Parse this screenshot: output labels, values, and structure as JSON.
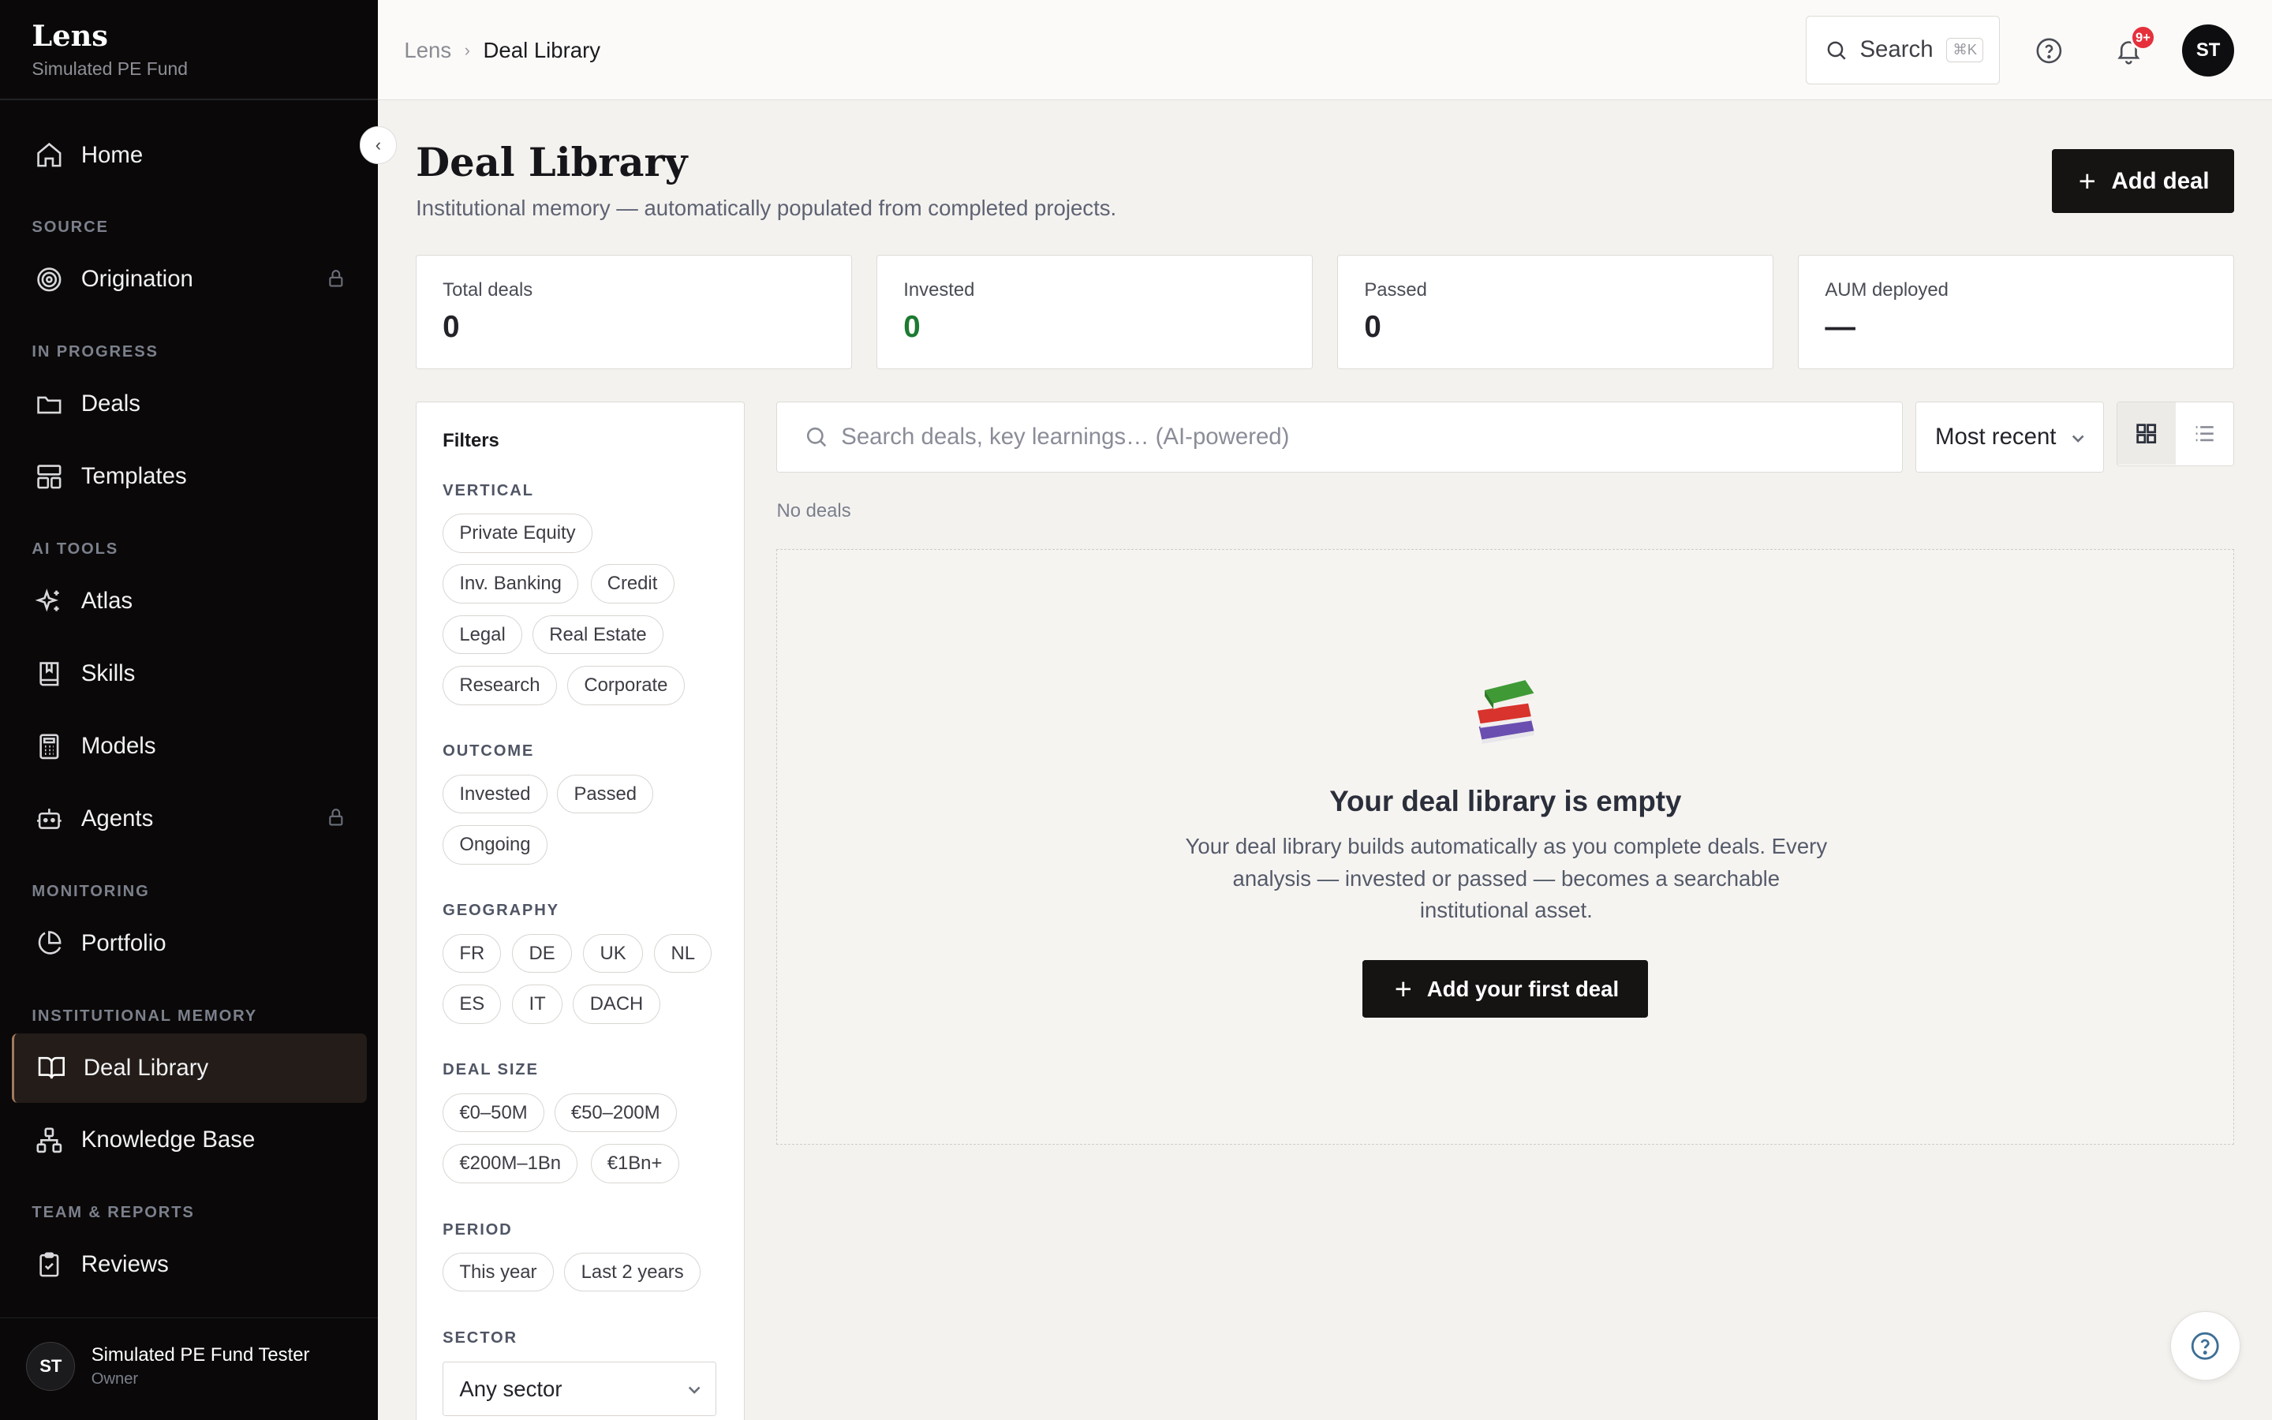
{
  "sidebar": {
    "brand_title": "Lens",
    "brand_subtitle": "Simulated PE Fund",
    "home": "Home",
    "sections": [
      "SOURCE",
      "IN PROGRESS",
      "AI TOOLS",
      "MONITORING",
      "INSTITUTIONAL MEMORY",
      "TEAM & REPORTS"
    ],
    "items": {
      "origination": "Origination",
      "deals": "Deals",
      "templates": "Templates",
      "atlas": "Atlas",
      "skills": "Skills",
      "models": "Models",
      "agents": "Agents",
      "portfolio": "Portfolio",
      "deal_library": "Deal Library",
      "knowledge_base": "Knowledge Base",
      "reviews": "Reviews"
    },
    "user": {
      "initials": "ST",
      "name": "Simulated PE Fund Tester",
      "role": "Owner"
    }
  },
  "topbar": {
    "breadcrumb": [
      "Lens",
      "Deal Library"
    ],
    "search_label": "Search",
    "search_shortcut": "⌘K",
    "notifications_badge": "9+",
    "avatar_initials": "ST"
  },
  "page": {
    "title": "Deal Library",
    "subtitle": "Institutional memory — automatically populated from completed projects.",
    "add_deal_label": "Add deal"
  },
  "stats": [
    {
      "label": "Total deals",
      "value": "0"
    },
    {
      "label": "Invested",
      "value": "0"
    },
    {
      "label": "Passed",
      "value": "0"
    },
    {
      "label": "AUM deployed",
      "value": "—"
    }
  ],
  "filters": {
    "title": "Filters",
    "vertical": {
      "label": "VERTICAL",
      "options": [
        "Private Equity",
        "Inv. Banking",
        "Credit",
        "Legal",
        "Real Estate",
        "Research",
        "Corporate"
      ]
    },
    "outcome": {
      "label": "OUTCOME",
      "options": [
        "Invested",
        "Passed",
        "Ongoing"
      ]
    },
    "geography": {
      "label": "GEOGRAPHY",
      "options": [
        "FR",
        "DE",
        "UK",
        "NL",
        "ES",
        "IT",
        "DACH"
      ]
    },
    "deal_size": {
      "label": "DEAL SIZE",
      "options": [
        "€0–50M",
        "€50–200M",
        "€200M–1Bn",
        "€1Bn+"
      ]
    },
    "period": {
      "label": "PERIOD",
      "options": [
        "This year",
        "Last 2 years"
      ]
    },
    "sector": {
      "label": "SECTOR",
      "value": "Any sector"
    }
  },
  "toolbar": {
    "search_placeholder": "Search deals, key learnings… (AI-powered)",
    "sort_value": "Most recent",
    "view_modes": [
      "grid-view",
      "list-view"
    ],
    "active_view": "grid-view"
  },
  "results": {
    "count_label": "No deals"
  },
  "empty_state": {
    "icon": "books-icon",
    "title": "Your deal library is empty",
    "text": "Your deal library builds automatically as you complete deals. Every analysis — invested or passed — becomes a searchable institutional asset.",
    "button_label": "Add your first deal"
  },
  "colors": {
    "accent_dark": "#161313",
    "sidebar_bg": "#0a0808",
    "invested_green": "#1d7a31",
    "badge_red": "#e5303c"
  }
}
